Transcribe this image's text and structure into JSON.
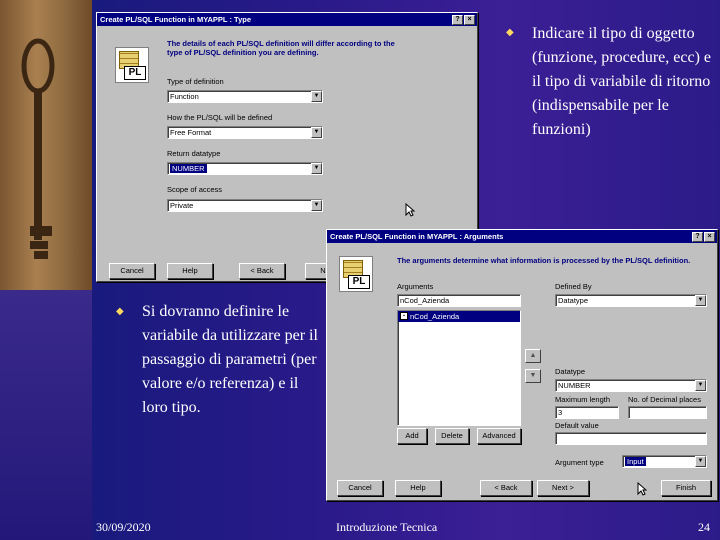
{
  "window1": {
    "title": "Create PL/SQL Function in MYAPPL : Type",
    "help_btn": "?",
    "close_btn": "×",
    "icon_text": "PL",
    "description": "The details of each PL/SQL definition will differ according to the type of PL/SQL definition you are defining.",
    "type_label": "Type of definition",
    "type_value": "Function",
    "how_label": "How the PL/SQL will be defined",
    "how_value": "Free Format",
    "return_label": "Return datatype",
    "return_value": "NUMBER",
    "scope_label": "Scope of access",
    "scope_value": "Private",
    "cancel": "Cancel",
    "help": "Help",
    "back": "< Back",
    "next": "Next"
  },
  "window2": {
    "title": "Create PL/SQL Function in MYAPPL : Arguments",
    "help_btn": "?",
    "close_btn": "×",
    "icon_text": "PL",
    "description": "The arguments determine what information is processed by the PL/SQL definition.",
    "arguments_label": "Arguments",
    "argument_input": "nCod_Azienda",
    "argument_list_item": "nCod_Azienda",
    "add": "Add",
    "delete": "Delete",
    "advanced": "Advanced",
    "defined_by_label": "Defined By",
    "defined_by_value": "Datatype",
    "datatype_label": "Datatype",
    "datatype_value": "NUMBER",
    "max_length_label": "Maximum length",
    "max_length_value": "3",
    "decimal_label": "No. of Decimal places",
    "decimal_value": "",
    "default_label": "Default value",
    "default_value": "",
    "argtype_label": "Argument type",
    "argtype_value": "Input",
    "cancel": "Cancel",
    "help": "Help",
    "back": "< Back",
    "next": "Next >",
    "finish": "Finish"
  },
  "bullets": {
    "top_right": "Indicare il tipo di oggetto (funzione, procedure, ecc) e il tipo di variabile di ritorno (indispensabile per le funzioni)",
    "bottom_left": "Si dovranno definire le variabile da utilizzare per il passaggio di parametri (per valore e/o referenza) e il loro tipo."
  },
  "footer": {
    "date": "30/09/2020",
    "center": "Introduzione Tecnica",
    "page": "24"
  },
  "colors": {
    "bullet": "#ffd860",
    "titlebar": "#000080"
  }
}
